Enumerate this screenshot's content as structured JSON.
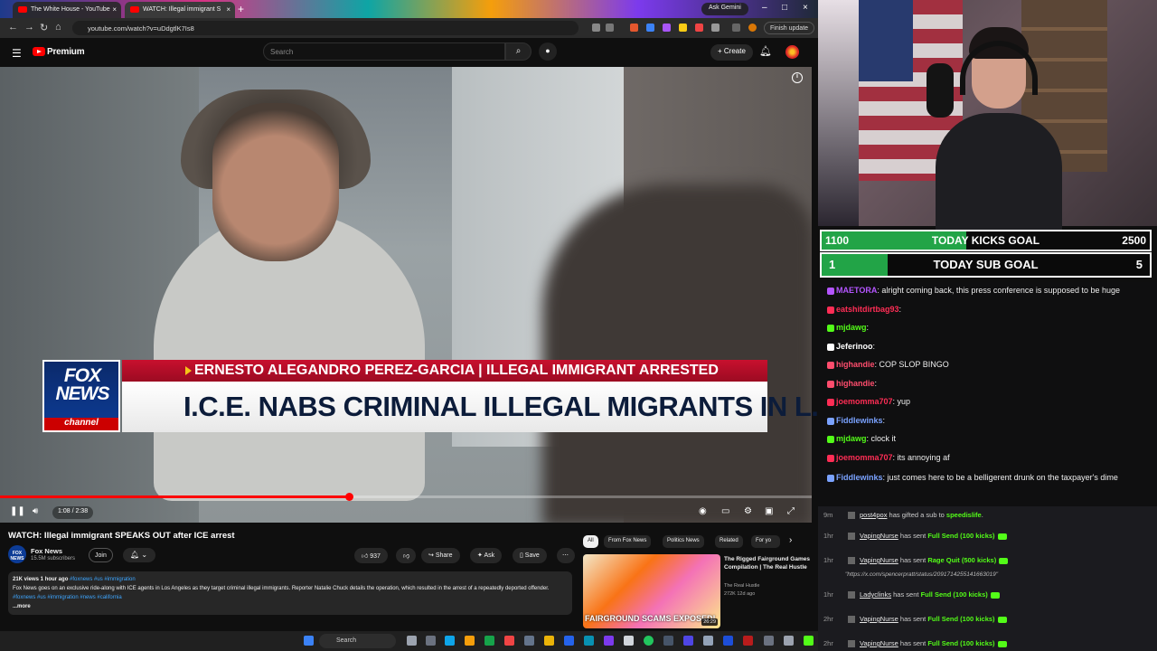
{
  "browser": {
    "tabs": [
      {
        "label": "The White House - YouTube"
      },
      {
        "label": "WATCH: Illegal immigrant S"
      }
    ],
    "ask_gemini": "Ask Gemini",
    "url": "youtube.com/watch?v=uDdgtlK7Is8",
    "finish_update": "Finish update"
  },
  "youtube": {
    "brand": "Premium",
    "search_placeholder": "Search",
    "create_label": "Create",
    "lower_third": {
      "logo_line1": "FOX",
      "logo_line2": "NEWS",
      "logo_line3": "channel",
      "name_line": "ERNESTO ALEGANDRO PEREZ-GARCIA | ILLEGAL IMMIGRANT ARRESTED",
      "headline": "I.C.E. NABS CRIMINAL ILLEGAL MIGRANTS IN L.A."
    },
    "player": {
      "time": "1:08 / 2:38",
      "progress": 0.43
    },
    "video_title": "WATCH: Illegal immigrant SPEAKS OUT after ICE arrest",
    "channel": {
      "name": "Fox News",
      "subs": "15.5M subscribers",
      "avatar_text": "FOX NEWS"
    },
    "join": "Join",
    "likes": "937",
    "share": "Share",
    "ask": "Ask",
    "save": "Save",
    "description": {
      "meta": "21K views  1 hour ago",
      "meta_tags": "#foxnews #us #immigration",
      "text": "Fox News goes on an exclusive ride-along with ICE agents in Los Angeles as they target criminal illegal immigrants. Reporter Natalie Chuck details the operation, which resulted in the arrest of a repeatedly deported offender.",
      "text_tags": "#foxnews #us #immigration #news #california",
      "more": "...more"
    },
    "chips": [
      "All",
      "From Fox News",
      "Politics News",
      "Related",
      "For yo"
    ],
    "recommended": {
      "thumb_text": "FAIRGROUND SCAMS EXPOSED!",
      "duration": "26:29",
      "title": "The Rigged Fairground Games Compilation | The Real Hustle",
      "channel": "The Real Hustle",
      "views": "272K  12d ago"
    }
  },
  "taskbar": {
    "search": "Search"
  },
  "stream": {
    "kicks_goal": {
      "current": "1100",
      "label": "TODAY KICKS GOAL",
      "target": "2500",
      "fraction": 0.44
    },
    "sub_goal": {
      "current": "1",
      "label": "TODAY SUB GOAL",
      "target": "5",
      "fraction": 0.2
    },
    "chat": [
      {
        "user": "MAETORA",
        "text": ": alright coming back, this press conference is supposed to be huge",
        "color": "#b455ff"
      },
      {
        "user": "eatshitdirtbag93",
        "text": ":",
        "color": "#ff2d55"
      },
      {
        "user": "mjdawg",
        "text": ":",
        "color": "#53fc18"
      },
      {
        "user": "Jeferinoo",
        "text": ":",
        "color": "#ffffff"
      },
      {
        "user": "highandie",
        "text": ": COP SLOP BINGO",
        "color": "#ff4d6d"
      },
      {
        "user": "highandie",
        "text": ":",
        "color": "#ff4d6d"
      },
      {
        "user": "joemomma707",
        "text": ": yup",
        "color": "#ff2d55"
      },
      {
        "user": "Fiddlewinks",
        "text": ":",
        "color": "#7aa2ff"
      },
      {
        "user": "mjdawg",
        "text": ": clock it",
        "color": "#53fc18"
      },
      {
        "user": "joemomma707",
        "text": ": its annoying af",
        "color": "#ff2d55"
      },
      {
        "user": "Fiddlewinks",
        "text": ": just comes here to be a belligerent drunk on the taxpayer's dime",
        "color": "#7aa2ff"
      }
    ],
    "events": [
      {
        "time": "9m",
        "user": "post4pox",
        "mid": " has gifted a sub to ",
        "bold": "speedislife",
        "end": "."
      },
      {
        "time": "1hr",
        "user": "VapingNurse",
        "mid": " has sent ",
        "bold": "Full Send (100 kicks)",
        "end": ""
      },
      {
        "time": "1hr",
        "user": "VapingNurse",
        "mid": " has sent ",
        "bold": "Rage Quit (500 kicks)",
        "end": ""
      },
      {
        "time": "1hr",
        "user": "Ladyclinks",
        "mid": " has sent ",
        "bold": "Full Send (100 kicks)",
        "end": ""
      },
      {
        "time": "2hr",
        "user": "VapingNurse",
        "mid": " has sent ",
        "bold": "Full Send (100 kicks)",
        "end": ""
      },
      {
        "time": "2hr",
        "user": "VapingNurse",
        "mid": " has sent ",
        "bold": "Full Send (100 kicks)",
        "end": ""
      }
    ],
    "event_link": "\"https://x.com/spencerpratt/status/2091714255141663019\""
  },
  "colors": {
    "yt_red": "#ff0000",
    "kick_green": "#53fc18",
    "goal_green": "#22a447",
    "fox_red": "#c8102e",
    "fox_blue": "#0d3c96"
  },
  "icons": [
    "menu-icon",
    "search-icon",
    "mic-icon",
    "plus-icon",
    "bell-icon",
    "info-icon",
    "pause-icon",
    "volume-icon",
    "captions-icon",
    "settings-icon",
    "miniplayer-icon",
    "fullscreen-icon",
    "like-icon",
    "dislike-icon",
    "share-icon",
    "save-icon",
    "more-icon",
    "chevron-right-icon",
    "windows-start-icon"
  ]
}
